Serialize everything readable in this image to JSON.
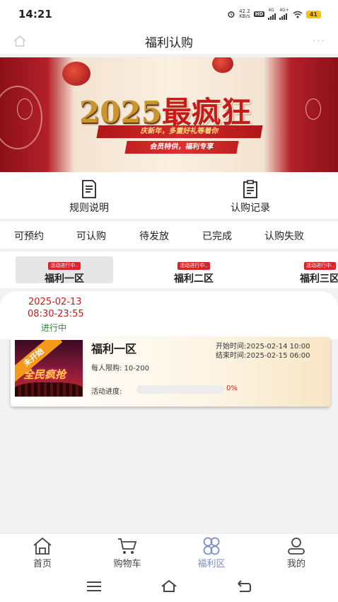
{
  "status_bar": {
    "time": "14:21",
    "net_speed_value": "42.2",
    "net_speed_unit": "KB/s",
    "hd": "HD",
    "signal1": "4G",
    "signal2": "4G+",
    "battery": "41"
  },
  "header": {
    "title": "福利认购",
    "more": "···"
  },
  "banner": {
    "title_num": "2025",
    "title_text": "最疯狂",
    "line1": "庆新年，多重好礼等着你",
    "line2": "会员特供，福利专享"
  },
  "actions": [
    {
      "label": "规则说明",
      "icon": "document-icon"
    },
    {
      "label": "认购记录",
      "icon": "clipboard-icon"
    }
  ],
  "status_tabs": [
    "可预约",
    "可认购",
    "待发放",
    "已完成",
    "认购失败"
  ],
  "zone_tabs": [
    {
      "badge": "活动进行中..",
      "label": "福利一区"
    },
    {
      "badge": "活动进行中..",
      "label": "福利二区"
    },
    {
      "badge": "活动进行中..",
      "label": "福利三区"
    }
  ],
  "session": {
    "date": "2025-02-13",
    "time": "08:30-23:55",
    "state": "进行中"
  },
  "product": {
    "ribbon": "未开始",
    "thumb_text": "全民疯抢",
    "title": "福利一区",
    "limit": "每人限购: 10-200",
    "start": "开始时间:2025-02-14 10:00",
    "end": "结束时间:2025-02-15 06:00",
    "progress_label": "活动进度:",
    "progress_value": 0,
    "progress_text": "0%"
  },
  "tabbar": [
    {
      "label": "首页",
      "icon": "home-icon"
    },
    {
      "label": "购物车",
      "icon": "cart-icon"
    },
    {
      "label": "福利区",
      "icon": "clover-icon"
    },
    {
      "label": "我的",
      "icon": "user-icon"
    }
  ],
  "colors": {
    "accent_red": "#c71a1a",
    "active_tab": "#7d8ec4",
    "progress_text": "#d8252a",
    "ribbon": "#f39a1a"
  }
}
